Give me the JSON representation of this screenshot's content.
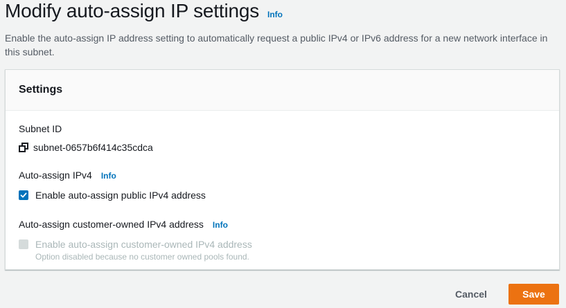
{
  "header": {
    "title": "Modify auto-assign IP settings",
    "info_label": "Info",
    "description": "Enable the auto-assign IP address setting to automatically request a public IPv4 or IPv6 address for a new network interface in this subnet."
  },
  "settings": {
    "title": "Settings",
    "subnet": {
      "label": "Subnet ID",
      "value": "subnet-0657b6f414c35cdca",
      "icon": "copy-icon"
    },
    "ipv4": {
      "label": "Auto-assign IPv4",
      "info_label": "Info",
      "checkbox_label": "Enable auto-assign public IPv4 address",
      "checked": true
    },
    "customer_owned": {
      "label": "Auto-assign customer-owned IPv4 address",
      "info_label": "Info",
      "checkbox_label": "Enable auto-assign customer-owned IPv4 address",
      "hint": "Option disabled because no customer owned pools found.",
      "checked": false,
      "disabled": true
    }
  },
  "actions": {
    "cancel_label": "Cancel",
    "save_label": "Save"
  },
  "colors": {
    "accent": "#0073bb",
    "primary_button": "#ec7211",
    "background": "#f2f3f3"
  }
}
